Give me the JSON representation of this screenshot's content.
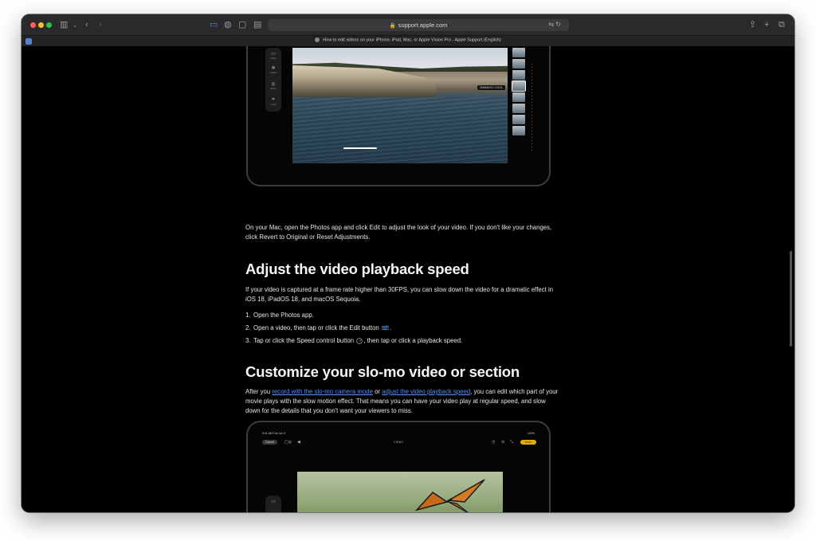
{
  "browser": {
    "url": "support.apple.com",
    "tab_title": "How to edit videos on your iPhone, iPad, Mac, or Apple Vision Pro - Apple Support (English)"
  },
  "device1": {
    "video_badge": "DRAMATIC COOL",
    "sidebar_labels": [
      "Video",
      "Adjust",
      "Filters",
      "Crop"
    ]
  },
  "article": {
    "para_mac": "On your Mac, open the Photos app and click Edit to adjust the look of your video. If you don't like your changes, click Revert to Original or Reset Adjustments.",
    "heading_speed": "Adjust the video playback speed",
    "para_speed": "If your video is captured at a frame rate higher than 30FPS, you can slow down the video for a dramatic effect in iOS 18, iPadOS 18, and macOS Sequoia.",
    "steps": [
      {
        "num": "1.",
        "text": "Open the Photos app."
      },
      {
        "num": "2.",
        "text_before": "Open a video, then tap or click the Edit button",
        "text_after": "."
      },
      {
        "num": "3.",
        "text_before": "Tap or click the Speed control button",
        "text_after": ", then tap or click a playback speed."
      }
    ],
    "heading_slomo": "Customize your slo-mo video or section",
    "para_slomo_1": "After you ",
    "link_record": "record with the slo-mo camera mode",
    "para_slomo_2": " or ",
    "link_adjust": "adjust the video playback speed",
    "para_slomo_3": ", you can edit which part of your movie plays with the slow motion effect. That means you can have your video play at regular speed, and slow down for the details that you don't want your viewers to miss."
  },
  "device2": {
    "status_time": "9:41 AM   Tue Jun 9",
    "status_right": "100%",
    "cancel": "Cancel",
    "mode_label": "VIDEO",
    "done": "Done"
  }
}
